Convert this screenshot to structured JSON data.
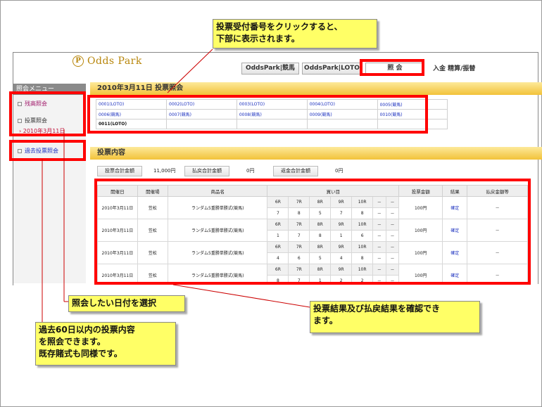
{
  "header": {
    "logo_text": "Odds Park",
    "logo_mark": "P",
    "tabs": [
      {
        "label": "OddsPark|競馬"
      },
      {
        "label": "OddsPark|LOTO"
      },
      {
        "label": "照 会"
      }
    ],
    "deposit_label": "入金 精算/振替"
  },
  "sidebar": {
    "title": "照会メニュー",
    "items": [
      {
        "label": "残高照会"
      },
      {
        "label": "投票照会"
      },
      {
        "label": "2010年3月11日"
      },
      {
        "label": "過去投票照会"
      }
    ]
  },
  "receipts": {
    "title": "2010年3月11日 投票照会",
    "rows": [
      [
        "0001(LOTO)",
        "0002(LOTO)",
        "0003(LOTO)",
        "0004(LOTO)",
        "0005(競馬)"
      ],
      [
        "0006(競馬)",
        "0007(競馬)",
        "0008(競馬)",
        "0009(競馬)",
        "0010(競馬)"
      ]
    ],
    "current": "0011(LOTO)"
  },
  "details": {
    "title": "投票内容",
    "summary": [
      {
        "label": "投票合計金額",
        "value": "11,000円"
      },
      {
        "label": "払戻合計金額",
        "value": "0円"
      },
      {
        "label": "返金合計金額",
        "value": "0円"
      }
    ],
    "columns": [
      "開催日",
      "開催場",
      "商品名",
      "買い目",
      "投票金額",
      "結果",
      "払戻金額等"
    ],
    "rows": [
      {
        "date": "2010年3月11日",
        "place": "笠松",
        "product": "ランダム5重勝単勝式(競馬)",
        "races": [
          "6R",
          "7R",
          "8R",
          "9R",
          "10R",
          "－",
          "－"
        ],
        "picks": [
          "7",
          "8",
          "5",
          "7",
          "8",
          "－",
          "－"
        ],
        "amount": "100円",
        "result": "確定",
        "payout": "－"
      },
      {
        "date": "2010年3月11日",
        "place": "笠松",
        "product": "ランダム5重勝単勝式(競馬)",
        "races": [
          "6R",
          "7R",
          "8R",
          "9R",
          "10R",
          "－",
          "－"
        ],
        "picks": [
          "1",
          "7",
          "8",
          "1",
          "6",
          "－",
          "－"
        ],
        "amount": "100円",
        "result": "確定",
        "payout": "－"
      },
      {
        "date": "2010年3月11日",
        "place": "笠松",
        "product": "ランダム5重勝単勝式(競馬)",
        "races": [
          "6R",
          "7R",
          "8R",
          "9R",
          "10R",
          "－",
          "－"
        ],
        "picks": [
          "4",
          "6",
          "5",
          "4",
          "8",
          "－",
          "－"
        ],
        "amount": "100円",
        "result": "確定",
        "payout": "－"
      },
      {
        "date": "2010年3月11日",
        "place": "笠松",
        "product": "ランダム5重勝単勝式(競馬)",
        "races": [
          "6R",
          "7R",
          "8R",
          "9R",
          "10R",
          "－",
          "－"
        ],
        "picks": [
          "8",
          "7",
          "1",
          "2",
          "2",
          "－",
          "－"
        ],
        "amount": "100円",
        "result": "確定",
        "payout": "－"
      }
    ]
  },
  "callouts": {
    "receipt_note": [
      "投票受付番号をクリックすると、",
      "下部に表示されます。"
    ],
    "date_note": "照会したい日付を選択",
    "result_note": [
      "投票結果及び払戻結果を確認でき",
      "ます。"
    ],
    "past_note": [
      "過去60日以内の投票内容",
      "を照会できます。",
      "既存賭式も同様です。"
    ]
  },
  "colors": {
    "highlight": "#ff0000",
    "note_bg": "#ffff66",
    "band": "#f2c23a",
    "link": "#1a2fbf"
  }
}
